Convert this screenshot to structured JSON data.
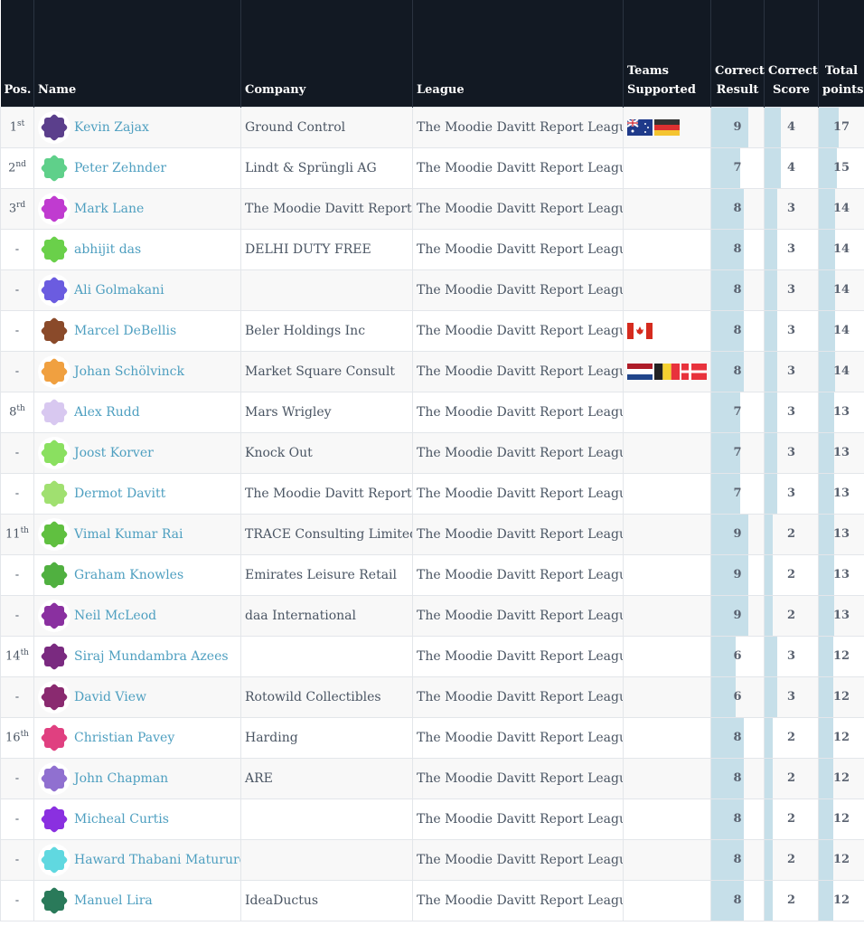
{
  "headers": {
    "pos": "Pos.",
    "name": "Name",
    "company": "Company",
    "league": "League",
    "teams": "Teams Supported",
    "correct_result": "Correct Result",
    "correct_score": "Correct Score",
    "total": "Total points"
  },
  "bar_color": "#c6dfe9",
  "rows": [
    {
      "pos": "1",
      "suf": "st",
      "name": "Kevin Zajax",
      "company": "Ground Control",
      "league": "The Moodie Davitt Report League",
      "flags": [
        "australia",
        "germany"
      ],
      "cr": 9,
      "cs": 4,
      "tp": 17,
      "avatar": "#5b3f8c"
    },
    {
      "pos": "2",
      "suf": "nd",
      "name": "Peter Zehnder",
      "company": "Lindt & Sprüngli AG",
      "league": "The Moodie Davitt Report League",
      "flags": [],
      "cr": 7,
      "cs": 4,
      "tp": 15,
      "avatar": "#5fd08a"
    },
    {
      "pos": "3",
      "suf": "rd",
      "name": "Mark Lane",
      "company": "The Moodie Davitt Report",
      "league": "The Moodie Davitt Report League",
      "flags": [],
      "cr": 8,
      "cs": 3,
      "tp": 14,
      "avatar": "#c03bd0"
    },
    {
      "pos": "-",
      "suf": "",
      "name": "abhijit das",
      "company": "DELHI DUTY FREE",
      "league": "The Moodie Davitt Report League",
      "flags": [],
      "cr": 8,
      "cs": 3,
      "tp": 14,
      "avatar": "#6ad04a"
    },
    {
      "pos": "-",
      "suf": "",
      "name": "Ali Golmakani",
      "company": "",
      "league": "The Moodie Davitt Report League",
      "flags": [],
      "cr": 8,
      "cs": 3,
      "tp": 14,
      "avatar": "#6b5ce0"
    },
    {
      "pos": "-",
      "suf": "",
      "name": "Marcel DeBellis",
      "company": "Beler Holdings Inc",
      "league": "The Moodie Davitt Report League",
      "flags": [
        "canada"
      ],
      "cr": 8,
      "cs": 3,
      "tp": 14,
      "avatar": "#8a4a2a"
    },
    {
      "pos": "-",
      "suf": "",
      "name": "Johan Schölvinck",
      "company": "Market Square Consult",
      "league": "The Moodie Davitt Report League",
      "flags": [
        "netherlands",
        "belgium",
        "denmark"
      ],
      "cr": 8,
      "cs": 3,
      "tp": 14,
      "avatar": "#f0a040"
    },
    {
      "pos": "8",
      "suf": "th",
      "name": "Alex Rudd",
      "company": "Mars Wrigley",
      "league": "The Moodie Davitt Report League",
      "flags": [],
      "cr": 7,
      "cs": 3,
      "tp": 13,
      "avatar": "#d8c8f0"
    },
    {
      "pos": "-",
      "suf": "",
      "name": "Joost Korver",
      "company": "Knock Out",
      "league": "The Moodie Davitt Report League",
      "flags": [],
      "cr": 7,
      "cs": 3,
      "tp": 13,
      "avatar": "#8ae060"
    },
    {
      "pos": "-",
      "suf": "",
      "name": "Dermot Davitt",
      "company": "The Moodie Davitt Report",
      "league": "The Moodie Davitt Report League",
      "flags": [],
      "cr": 7,
      "cs": 3,
      "tp": 13,
      "avatar": "#a0e070"
    },
    {
      "pos": "11",
      "suf": "th",
      "name": "Vimal Kumar Rai",
      "company": "TRACE Consulting Limited",
      "league": "The Moodie Davitt Report League",
      "flags": [],
      "cr": 9,
      "cs": 2,
      "tp": 13,
      "avatar": "#60c040"
    },
    {
      "pos": "-",
      "suf": "",
      "name": "Graham Knowles",
      "company": "Emirates Leisure Retail",
      "league": "The Moodie Davitt Report League",
      "flags": [],
      "cr": 9,
      "cs": 2,
      "tp": 13,
      "avatar": "#50b040"
    },
    {
      "pos": "-",
      "suf": "",
      "name": "Neil McLeod",
      "company": "daa International",
      "league": "The Moodie Davitt Report League",
      "flags": [],
      "cr": 9,
      "cs": 2,
      "tp": 13,
      "avatar": "#8a30a0"
    },
    {
      "pos": "14",
      "suf": "th",
      "name": "Siraj Mundambra Azees",
      "company": "",
      "league": "The Moodie Davitt Report League",
      "flags": [],
      "cr": 6,
      "cs": 3,
      "tp": 12,
      "avatar": "#7a2a80"
    },
    {
      "pos": "-",
      "suf": "",
      "name": "David View",
      "company": "Rotowild Collectibles",
      "league": "The Moodie Davitt Report League",
      "flags": [],
      "cr": 6,
      "cs": 3,
      "tp": 12,
      "avatar": "#8a2a70"
    },
    {
      "pos": "16",
      "suf": "th",
      "name": "Christian Pavey",
      "company": "Harding",
      "league": "The Moodie Davitt Report League",
      "flags": [],
      "cr": 8,
      "cs": 2,
      "tp": 12,
      "avatar": "#e04080"
    },
    {
      "pos": "-",
      "suf": "",
      "name": "John Chapman",
      "company": "ARE",
      "league": "The Moodie Davitt Report League",
      "flags": [],
      "cr": 8,
      "cs": 2,
      "tp": 12,
      "avatar": "#9070d0"
    },
    {
      "pos": "-",
      "suf": "",
      "name": "Micheal Curtis",
      "company": "",
      "league": "The Moodie Davitt Report League",
      "flags": [],
      "cr": 8,
      "cs": 2,
      "tp": 12,
      "avatar": "#8a30e0"
    },
    {
      "pos": "-",
      "suf": "",
      "name": "Haward Thabani Maturure",
      "company": "",
      "league": "The Moodie Davitt Report League",
      "flags": [],
      "cr": 8,
      "cs": 2,
      "tp": 12,
      "avatar": "#60d8e0"
    },
    {
      "pos": "-",
      "suf": "",
      "name": "Manuel Lira",
      "company": "IdeaDuctus",
      "league": "The Moodie Davitt Report League",
      "flags": [],
      "cr": 8,
      "cs": 2,
      "tp": 12,
      "avatar": "#2a7a5a"
    }
  ]
}
